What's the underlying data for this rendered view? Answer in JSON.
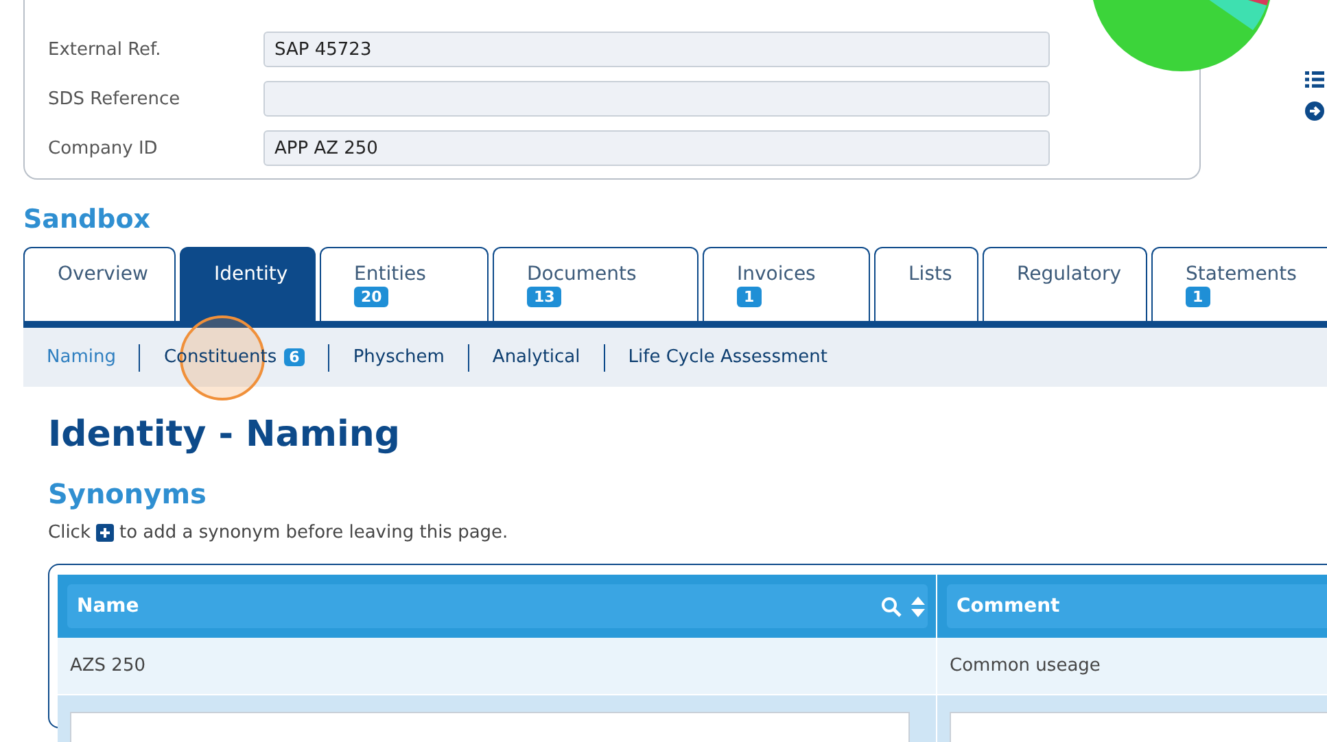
{
  "details": [
    {
      "label": "External Ref.",
      "value": "SAP 45723"
    },
    {
      "label": "SDS Reference"
    },
    {
      "label": "Company ID",
      "value": "APP AZ 250"
    }
  ],
  "section_title": "Sandbox",
  "tabs": [
    {
      "label": "Overview",
      "selected": false
    },
    {
      "label": "Identity",
      "selected": true
    },
    {
      "label": "Entities",
      "selected": false,
      "badge": "20"
    },
    {
      "label": "Documents",
      "selected": false,
      "badge": "13"
    },
    {
      "label": "Invoices",
      "selected": false,
      "badge": "1"
    },
    {
      "label": "Lists",
      "selected": false
    },
    {
      "label": "Regulatory",
      "selected": false
    },
    {
      "label": "Statements",
      "selected": false,
      "badge": "1"
    }
  ],
  "subtabs": [
    {
      "label": "Naming",
      "selected": true
    },
    {
      "label": "Constituents",
      "selected": false,
      "badge": "6"
    },
    {
      "label": "Physchem",
      "selected": false
    },
    {
      "label": "Analytical",
      "selected": false
    },
    {
      "label": "Life Cycle Assessment",
      "selected": false
    }
  ],
  "page_title": "Identity - Naming",
  "section_heading": "Synonyms",
  "hint_prefix": "Click",
  "hint_text": "to add a synonym before leaving this page.",
  "table": {
    "columns": [
      {
        "label": "Name",
        "searchable": true,
        "sortable": true
      },
      {
        "label": "Comment"
      }
    ],
    "rows": [
      {
        "cells": [
          "AZS 250",
          "Common useage"
        ],
        "selected": false
      },
      {
        "selected": true
      }
    ]
  }
}
